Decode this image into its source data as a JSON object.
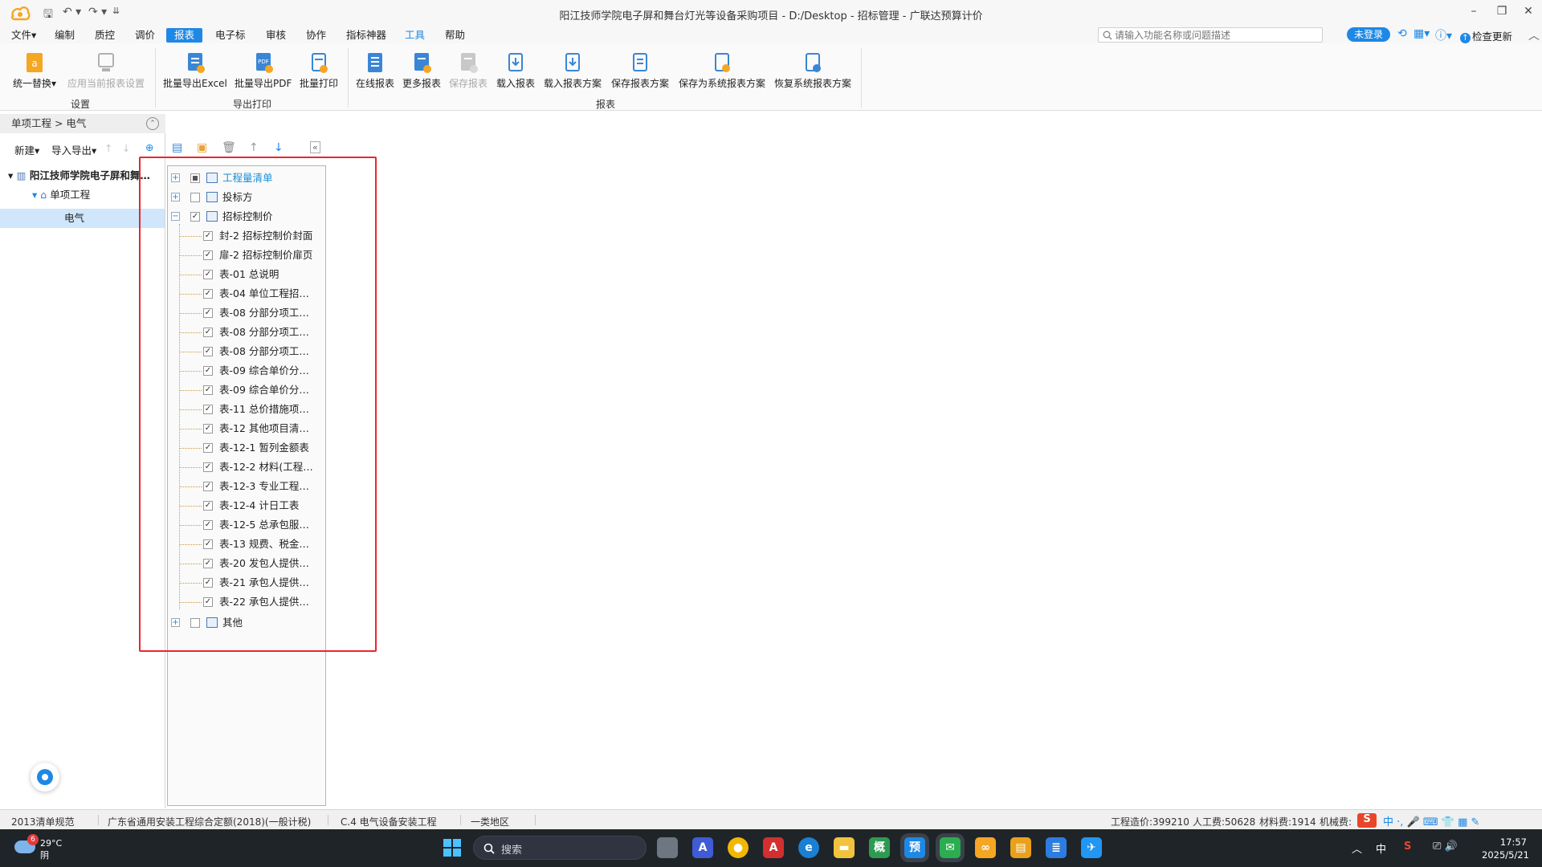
{
  "window": {
    "title": "阳江技师学院电子屏和舞台灯光等设备采购项目 - D:/Desktop - 招标管理 - 广联达预算计价",
    "minimize": "–",
    "restore": "❐",
    "close": "✕"
  },
  "quick_access": {
    "save": "🖫",
    "undo": "↶ ▾",
    "redo": "↷ ▾",
    "more": "⇊"
  },
  "menu": [
    {
      "label": "文件▾"
    },
    {
      "label": "编制"
    },
    {
      "label": "质控"
    },
    {
      "label": "调价"
    },
    {
      "label": "报表"
    },
    {
      "label": "电子标"
    },
    {
      "label": "审核"
    },
    {
      "label": "协作"
    },
    {
      "label": "指标神器"
    },
    {
      "label": "工具"
    },
    {
      "label": "帮助"
    }
  ],
  "search": {
    "placeholder": "请输入功能名称或问题描述"
  },
  "login_badge": "未登录",
  "check_update": "检查更新",
  "ribbon": {
    "settings": {
      "replace": "统一替换▾",
      "apply": "应用当前报表设置",
      "group": "设置"
    },
    "export": {
      "excel": "批量导出Excel",
      "pdf": "批量导出PDF",
      "print": "批量打印",
      "group": "导出打印",
      "pdf_tag": "PDF"
    },
    "report": {
      "online": "在线报表",
      "more": "更多报表",
      "save": "保存报表",
      "load": "载入报表",
      "load_scheme": "载入报表方案",
      "save_scheme": "保存报表方案",
      "save_sys": "保存为系统报表方案",
      "restore_sys": "恢复系统报表方案",
      "group": "报表"
    }
  },
  "left_panel": {
    "breadcrumb": "单项工程 > 电气",
    "toolbar": {
      "new": "新建▾",
      "import_export": "导入导出▾"
    },
    "tree": {
      "project": "阳江技师学院电子屏和舞…",
      "sub": "单项工程",
      "leaf": "电气"
    }
  },
  "report_tree": {
    "top": [
      {
        "label": "工程量清单"
      },
      {
        "label": "投标方"
      },
      {
        "label": "招标控制价"
      }
    ],
    "children": [
      {
        "label": "封-2 招标控制价封面"
      },
      {
        "label": "扉-2 招标控制价扉页"
      },
      {
        "label": "表-01 总说明"
      },
      {
        "label": "表-04 单位工程招…"
      },
      {
        "label": "表-08 分部分项工…"
      },
      {
        "label": "表-08 分部分项工…"
      },
      {
        "label": "表-08 分部分项工…"
      },
      {
        "label": "表-09 综合单价分…"
      },
      {
        "label": "表-09 综合单价分…"
      },
      {
        "label": "表-11 总价措施项…"
      },
      {
        "label": "表-12 其他项目清…"
      },
      {
        "label": "表-12-1 暂列金额表"
      },
      {
        "label": "表-12-2 材料(工程…"
      },
      {
        "label": "表-12-3 专业工程…"
      },
      {
        "label": "表-12-4 计日工表"
      },
      {
        "label": "表-12-5 总承包服…"
      },
      {
        "label": "表-13 规费、税金…"
      },
      {
        "label": "表-20 发包人提供…"
      },
      {
        "label": "表-21 承包人提供…"
      },
      {
        "label": "表-22 承包人提供…"
      }
    ],
    "last": {
      "label": "其他"
    }
  },
  "status": {
    "norm": "2013清单规范",
    "quota": "广东省通用安装工程综合定额(2018)(一般计税)",
    "section": "C.4 电气设备安装工程",
    "region": "一类地区",
    "cost": "工程造价:399210",
    "labor": "人工费:50628",
    "material": "材料费:1914",
    "machine": "机械费:",
    "ime": "中 ·, 🎤 ⌨ 👕 ▦ ✎",
    "ime_logo": "S"
  },
  "taskbar": {
    "weather_temp": "29°C",
    "weather_desc": "阴",
    "weather_badge": "6",
    "search": "搜索",
    "time": "17:57",
    "date": "2025/5/21",
    "tray_lang": "中",
    "tray_chevron": "︿",
    "tray_s": "S",
    "tray_icons": "⎚ 🔊",
    "apps": [
      {
        "glyph": "A"
      },
      {
        "glyph": "●"
      },
      {
        "glyph": "A"
      },
      {
        "glyph": "e"
      },
      {
        "glyph": "▬"
      },
      {
        "glyph": "概"
      },
      {
        "glyph": "预"
      },
      {
        "glyph": "✉"
      },
      {
        "glyph": "∞"
      },
      {
        "glyph": "▤"
      },
      {
        "glyph": "≣"
      },
      {
        "glyph": "✈"
      }
    ]
  },
  "colors": {
    "accent": "#1e88e5",
    "highlight_box": "#e8262f",
    "selection": "#cfe6fb"
  }
}
